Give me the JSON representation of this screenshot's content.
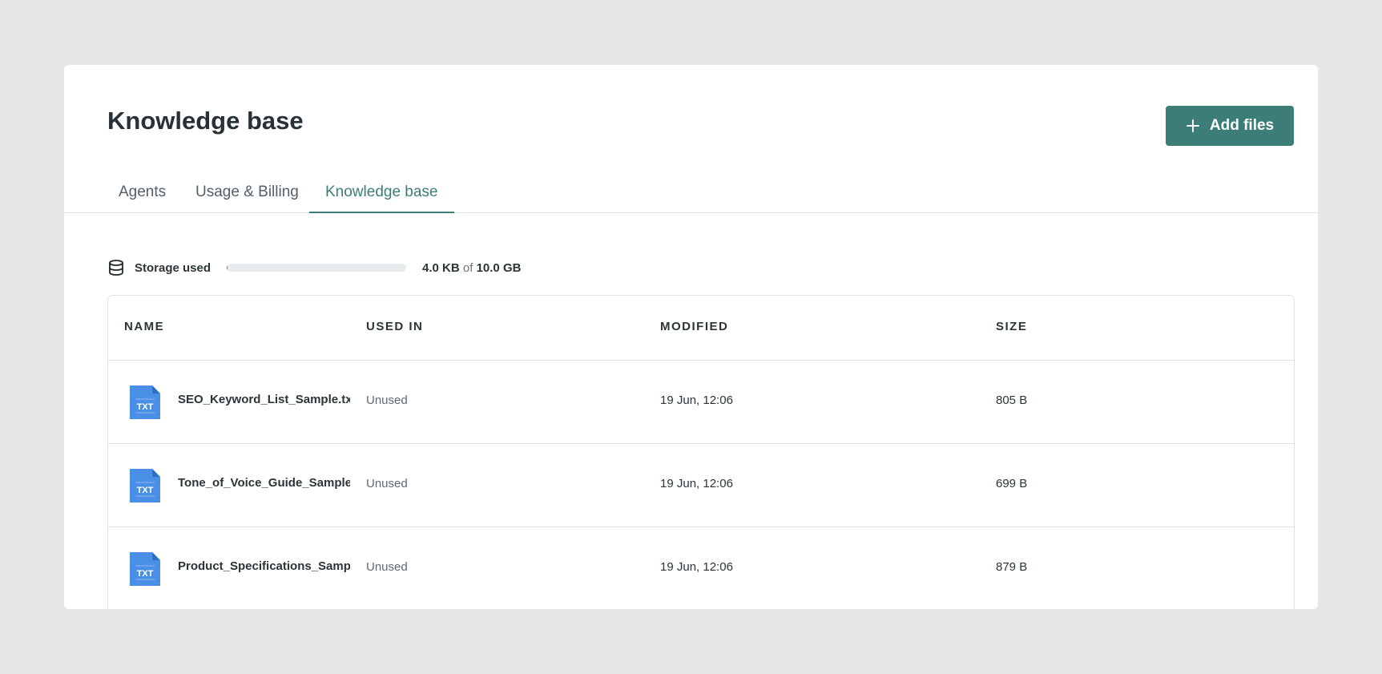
{
  "page": {
    "title": "Knowledge base",
    "add_button_label": "Add files",
    "accent_color": "#3d7d77"
  },
  "tabs": [
    {
      "label": "Agents",
      "active": false
    },
    {
      "label": "Usage & Billing",
      "active": false
    },
    {
      "label": "Knowledge base",
      "active": true
    }
  ],
  "storage": {
    "label": "Storage used",
    "used": "4.0 KB",
    "of": "of",
    "total": "10.0 GB",
    "fill_fraction": 0.0004
  },
  "table": {
    "columns": [
      "NAME",
      "USED IN",
      "MODIFIED",
      "SIZE"
    ],
    "rows": [
      {
        "icon": "txt-file-icon",
        "icon_label": "TXT",
        "name": "SEO_Keyword_List_Sample.txt",
        "used_in": "Unused",
        "modified": "19 Jun, 12:06",
        "size": "805 B"
      },
      {
        "icon": "txt-file-icon",
        "icon_label": "TXT",
        "name": "Tone_of_Voice_Guide_Sample.",
        "used_in": "Unused",
        "modified": "19 Jun, 12:06",
        "size": "699 B"
      },
      {
        "icon": "txt-file-icon",
        "icon_label": "TXT",
        "name": "Product_Specifications_Sampl",
        "used_in": "Unused",
        "modified": "19 Jun, 12:06",
        "size": "879 B"
      }
    ]
  }
}
